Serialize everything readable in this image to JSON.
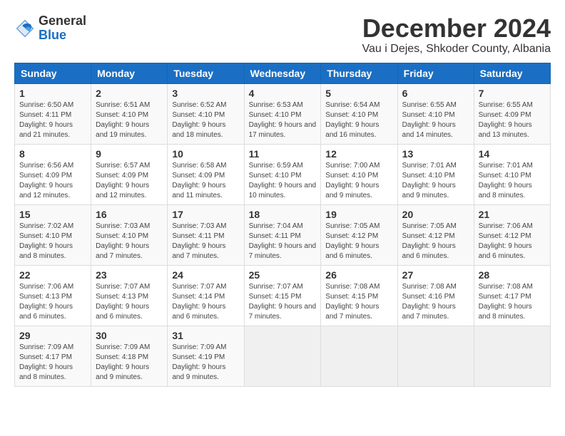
{
  "logo": {
    "general": "General",
    "blue": "Blue"
  },
  "header": {
    "month": "December 2024",
    "location": "Vau i Dejes, Shkoder County, Albania"
  },
  "days_of_week": [
    "Sunday",
    "Monday",
    "Tuesday",
    "Wednesday",
    "Thursday",
    "Friday",
    "Saturday"
  ],
  "weeks": [
    [
      {
        "day": "1",
        "sunrise": "6:50 AM",
        "sunset": "4:11 PM",
        "daylight": "9 hours and 21 minutes."
      },
      {
        "day": "2",
        "sunrise": "6:51 AM",
        "sunset": "4:10 PM",
        "daylight": "9 hours and 19 minutes."
      },
      {
        "day": "3",
        "sunrise": "6:52 AM",
        "sunset": "4:10 PM",
        "daylight": "9 hours and 18 minutes."
      },
      {
        "day": "4",
        "sunrise": "6:53 AM",
        "sunset": "4:10 PM",
        "daylight": "9 hours and 17 minutes."
      },
      {
        "day": "5",
        "sunrise": "6:54 AM",
        "sunset": "4:10 PM",
        "daylight": "9 hours and 16 minutes."
      },
      {
        "day": "6",
        "sunrise": "6:55 AM",
        "sunset": "4:10 PM",
        "daylight": "9 hours and 14 minutes."
      },
      {
        "day": "7",
        "sunrise": "6:55 AM",
        "sunset": "4:09 PM",
        "daylight": "9 hours and 13 minutes."
      }
    ],
    [
      {
        "day": "8",
        "sunrise": "6:56 AM",
        "sunset": "4:09 PM",
        "daylight": "9 hours and 12 minutes."
      },
      {
        "day": "9",
        "sunrise": "6:57 AM",
        "sunset": "4:09 PM",
        "daylight": "9 hours and 12 minutes."
      },
      {
        "day": "10",
        "sunrise": "6:58 AM",
        "sunset": "4:09 PM",
        "daylight": "9 hours and 11 minutes."
      },
      {
        "day": "11",
        "sunrise": "6:59 AM",
        "sunset": "4:10 PM",
        "daylight": "9 hours and 10 minutes."
      },
      {
        "day": "12",
        "sunrise": "7:00 AM",
        "sunset": "4:10 PM",
        "daylight": "9 hours and 9 minutes."
      },
      {
        "day": "13",
        "sunrise": "7:01 AM",
        "sunset": "4:10 PM",
        "daylight": "9 hours and 9 minutes."
      },
      {
        "day": "14",
        "sunrise": "7:01 AM",
        "sunset": "4:10 PM",
        "daylight": "9 hours and 8 minutes."
      }
    ],
    [
      {
        "day": "15",
        "sunrise": "7:02 AM",
        "sunset": "4:10 PM",
        "daylight": "9 hours and 8 minutes."
      },
      {
        "day": "16",
        "sunrise": "7:03 AM",
        "sunset": "4:10 PM",
        "daylight": "9 hours and 7 minutes."
      },
      {
        "day": "17",
        "sunrise": "7:03 AM",
        "sunset": "4:11 PM",
        "daylight": "9 hours and 7 minutes."
      },
      {
        "day": "18",
        "sunrise": "7:04 AM",
        "sunset": "4:11 PM",
        "daylight": "9 hours and 7 minutes."
      },
      {
        "day": "19",
        "sunrise": "7:05 AM",
        "sunset": "4:12 PM",
        "daylight": "9 hours and 6 minutes."
      },
      {
        "day": "20",
        "sunrise": "7:05 AM",
        "sunset": "4:12 PM",
        "daylight": "9 hours and 6 minutes."
      },
      {
        "day": "21",
        "sunrise": "7:06 AM",
        "sunset": "4:12 PM",
        "daylight": "9 hours and 6 minutes."
      }
    ],
    [
      {
        "day": "22",
        "sunrise": "7:06 AM",
        "sunset": "4:13 PM",
        "daylight": "9 hours and 6 minutes."
      },
      {
        "day": "23",
        "sunrise": "7:07 AM",
        "sunset": "4:13 PM",
        "daylight": "9 hours and 6 minutes."
      },
      {
        "day": "24",
        "sunrise": "7:07 AM",
        "sunset": "4:14 PM",
        "daylight": "9 hours and 6 minutes."
      },
      {
        "day": "25",
        "sunrise": "7:07 AM",
        "sunset": "4:15 PM",
        "daylight": "9 hours and 7 minutes."
      },
      {
        "day": "26",
        "sunrise": "7:08 AM",
        "sunset": "4:15 PM",
        "daylight": "9 hours and 7 minutes."
      },
      {
        "day": "27",
        "sunrise": "7:08 AM",
        "sunset": "4:16 PM",
        "daylight": "9 hours and 7 minutes."
      },
      {
        "day": "28",
        "sunrise": "7:08 AM",
        "sunset": "4:17 PM",
        "daylight": "9 hours and 8 minutes."
      }
    ],
    [
      {
        "day": "29",
        "sunrise": "7:09 AM",
        "sunset": "4:17 PM",
        "daylight": "9 hours and 8 minutes."
      },
      {
        "day": "30",
        "sunrise": "7:09 AM",
        "sunset": "4:18 PM",
        "daylight": "9 hours and 9 minutes."
      },
      {
        "day": "31",
        "sunrise": "7:09 AM",
        "sunset": "4:19 PM",
        "daylight": "9 hours and 9 minutes."
      },
      null,
      null,
      null,
      null
    ]
  ]
}
